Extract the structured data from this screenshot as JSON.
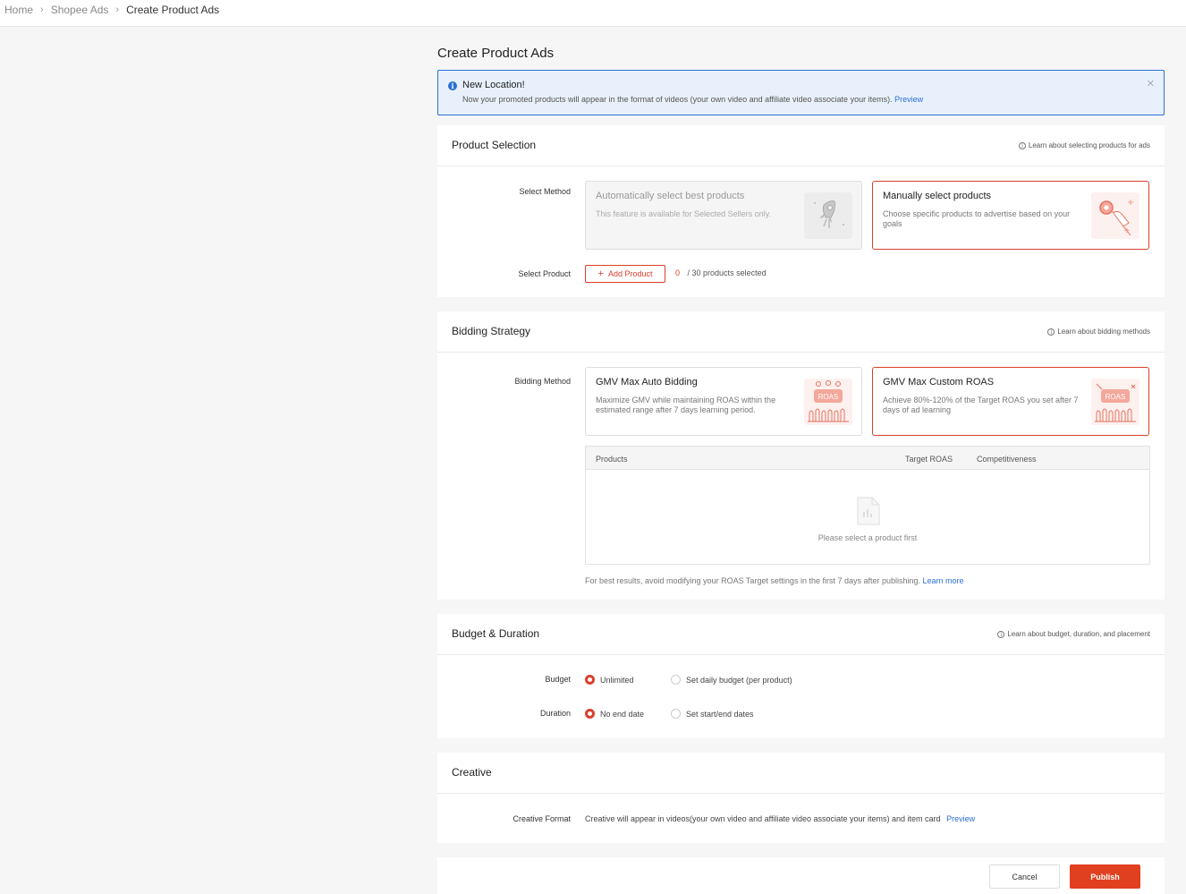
{
  "breadcrumb": {
    "home": "Home",
    "section": "Shopee Ads",
    "current": "Create Product Ads"
  },
  "page": {
    "title": "Create Product Ads"
  },
  "notice": {
    "title": "New Location!",
    "body": "Now your promoted products will appear in the format of videos (your own video and affiliate video associate your items).",
    "link": "Preview",
    "close": "✕"
  },
  "product_selection": {
    "title": "Product Selection",
    "learn": "Learn about selecting products for ads",
    "method_label": "Select Method",
    "auto": {
      "title": "Automatically select best products",
      "desc": "This feature is available for Selected Sellers only."
    },
    "manual": {
      "title": "Manually select products",
      "desc": "Choose specific products to advertise based on your goals"
    },
    "product_label": "Select Product",
    "add_button": "Add Product",
    "count_selected": "0",
    "count_total": "/ 30 products selected"
  },
  "bidding": {
    "title": "Bidding Strategy",
    "learn": "Learn about bidding methods",
    "method_label": "Bidding Method",
    "auto": {
      "title": "GMV Max Auto Bidding",
      "desc": "Maximize GMV while maintaining ROAS within the estimated range after 7 days learning period.",
      "badge": "ROAS"
    },
    "custom": {
      "title": "GMV Max Custom ROAS",
      "desc": "Achieve 80%-120% of the Target ROAS you set after 7 days of ad learning",
      "badge": "ROAS"
    },
    "table": {
      "col_products": "Products",
      "col_target": "Target ROAS",
      "col_competitiveness": "Competitiveness",
      "empty": "Please select a product first"
    },
    "hint": "For best results, avoid modifying your ROAS Target settings in the first 7 days after publishing.",
    "hint_link": "Learn more"
  },
  "budget": {
    "title": "Budget & Duration",
    "learn": "Learn about budget, duration, and placement",
    "budget_label": "Budget",
    "budget_unlimited": "Unlimited",
    "budget_daily": "Set daily budget (per product)",
    "duration_label": "Duration",
    "duration_none": "No end date",
    "duration_dates": "Set start/end dates"
  },
  "creative": {
    "title": "Creative",
    "format_label": "Creative Format",
    "format_text": "Creative will appear in videos(your own video and affiliate video associate your items) and item card",
    "format_link": "Preview"
  },
  "footer": {
    "cancel": "Cancel",
    "publish": "Publish"
  },
  "colors": {
    "accent": "#d9402b",
    "link": "#2a6fd6"
  }
}
